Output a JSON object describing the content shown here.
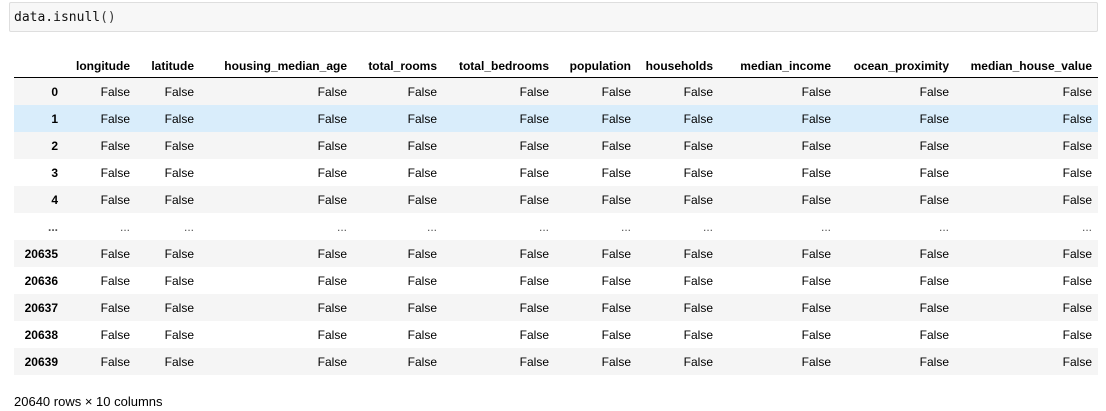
{
  "cell": {
    "code_prefix": "data.isnull",
    "code_paren": "()"
  },
  "table": {
    "columns": [
      "longitude",
      "latitude",
      "housing_median_age",
      "total_rooms",
      "total_bedrooms",
      "population",
      "households",
      "median_income",
      "ocean_proximity",
      "median_house_value"
    ],
    "rows": [
      {
        "index": "0",
        "values": [
          "False",
          "False",
          "False",
          "False",
          "False",
          "False",
          "False",
          "False",
          "False",
          "False"
        ]
      },
      {
        "index": "1",
        "values": [
          "False",
          "False",
          "False",
          "False",
          "False",
          "False",
          "False",
          "False",
          "False",
          "False"
        ],
        "highlighted": true
      },
      {
        "index": "2",
        "values": [
          "False",
          "False",
          "False",
          "False",
          "False",
          "False",
          "False",
          "False",
          "False",
          "False"
        ]
      },
      {
        "index": "3",
        "values": [
          "False",
          "False",
          "False",
          "False",
          "False",
          "False",
          "False",
          "False",
          "False",
          "False"
        ]
      },
      {
        "index": "4",
        "values": [
          "False",
          "False",
          "False",
          "False",
          "False",
          "False",
          "False",
          "False",
          "False",
          "False"
        ]
      },
      {
        "index": "...",
        "values": [
          "...",
          "...",
          "...",
          "...",
          "...",
          "...",
          "...",
          "...",
          "...",
          "..."
        ],
        "ellipsis": true
      },
      {
        "index": "20635",
        "values": [
          "False",
          "False",
          "False",
          "False",
          "False",
          "False",
          "False",
          "False",
          "False",
          "False"
        ]
      },
      {
        "index": "20636",
        "values": [
          "False",
          "False",
          "False",
          "False",
          "False",
          "False",
          "False",
          "False",
          "False",
          "False"
        ]
      },
      {
        "index": "20637",
        "values": [
          "False",
          "False",
          "False",
          "False",
          "False",
          "False",
          "False",
          "False",
          "False",
          "False"
        ]
      },
      {
        "index": "20638",
        "values": [
          "False",
          "False",
          "False",
          "False",
          "False",
          "False",
          "False",
          "False",
          "False",
          "False"
        ]
      },
      {
        "index": "20639",
        "values": [
          "False",
          "False",
          "False",
          "False",
          "False",
          "False",
          "False",
          "False",
          "False",
          "False"
        ]
      }
    ]
  },
  "footer": {
    "shape_text": "20640 rows × 10 columns"
  },
  "colors": {
    "highlight_row": "#d9edfb",
    "stripe_row": "#f5f5f5",
    "code_background": "#f7f7f7"
  }
}
